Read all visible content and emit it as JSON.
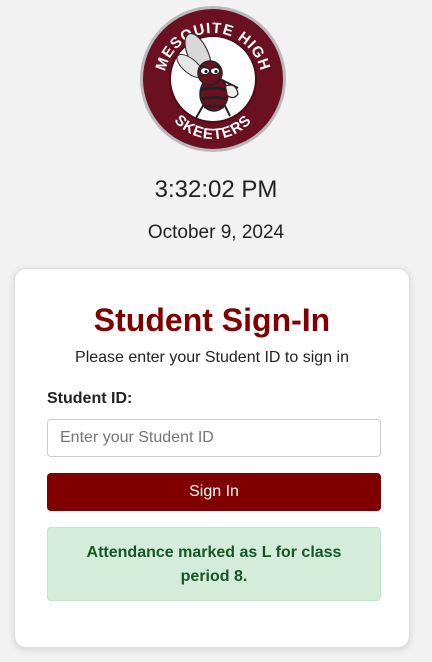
{
  "logo": {
    "top_text": "MESQUITE HIGH",
    "bottom_text": "SKEETERS",
    "colors": {
      "maroon": "#6b1020",
      "ring": "#ffffff",
      "dark": "#222222"
    }
  },
  "clock": {
    "time": "3:32:02 PM",
    "date": "October 9, 2024"
  },
  "card": {
    "title": "Student Sign-In",
    "subtitle": "Please enter your Student ID to sign in",
    "field_label": "Student ID:",
    "input_placeholder": "Enter your Student ID",
    "input_value": "",
    "button_label": "Sign In",
    "alert_text": "Attendance marked as L for class period 8."
  },
  "colors": {
    "accent": "#800000",
    "success_bg": "#d4edda",
    "success_text": "#155724"
  }
}
